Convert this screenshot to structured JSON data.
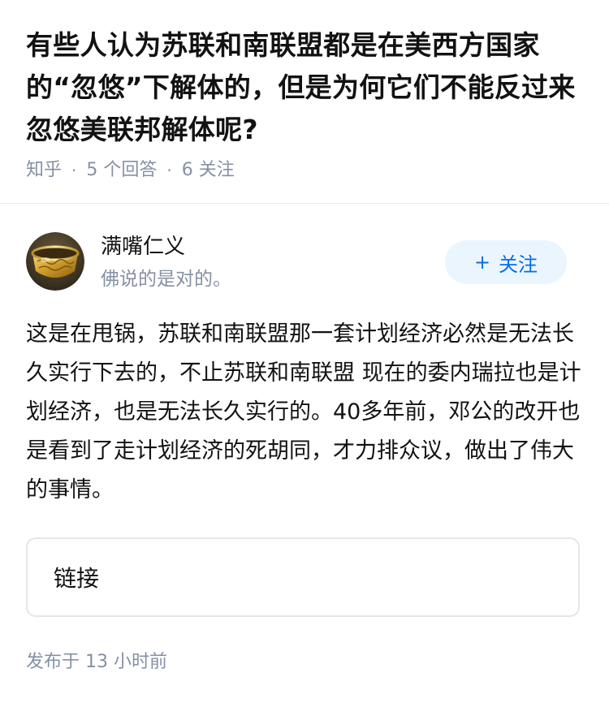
{
  "question": {
    "title": "有些人认为苏联和南联盟都是在美西方国家的“忽悠”下解体的，但是为何它们不能反过来忽悠美联邦解体呢?",
    "source": "知乎",
    "answers_count": "5 个回答",
    "followers_count": "6 关注"
  },
  "author": {
    "name": "满嘴仁义",
    "bio": "佛说的是对的。",
    "avatar_icon": "golden-bowl-avatar",
    "follow_label": "关注",
    "follow_icon": "plus-icon"
  },
  "answer": {
    "text": "这是在甩锅，苏联和南联盟那一套计划经济必然是无法长久实行下去的，不止苏联和南联盟 现在的委内瑞拉也是计划经济，也是无法长久实行的。40多年前，邓公的改开也是看到了走计划经济的死胡同，才力排众议，做出了伟大的事情。"
  },
  "link_card": {
    "label": "链接"
  },
  "footer": {
    "published": "发布于  13 小时前"
  },
  "colors": {
    "text_primary": "#121212",
    "text_secondary": "#8590a6",
    "accent_blue": "#056de8",
    "button_bg": "#ebf5fd",
    "border": "#e6e6e6"
  }
}
